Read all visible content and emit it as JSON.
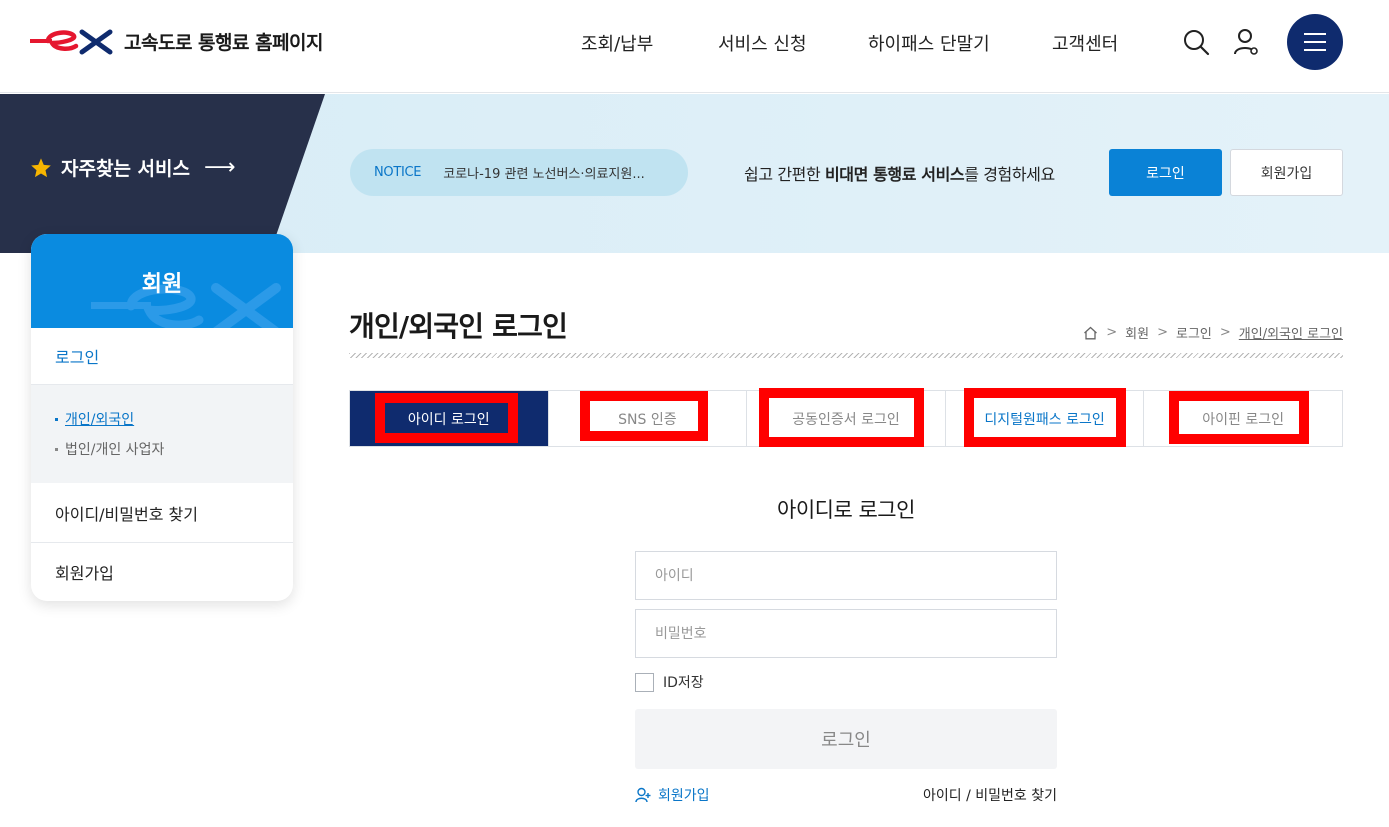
{
  "header": {
    "logo_text": "고속도로 통행료 홈페이지",
    "nav": [
      "조회/납부",
      "서비스 신청",
      "하이패스 단말기",
      "고객센터"
    ],
    "search_icon": "search-icon",
    "user_icon": "user-icon",
    "menu_icon": "hamburger-menu-icon"
  },
  "banner": {
    "favorites": "자주찾는 서비스",
    "favorites_arrow": "⟶",
    "notice_label": "NOTICE",
    "notice_text": "코로나-19 관련 노선버스·의료지원...",
    "message_pre": "쉽고 간편한 ",
    "message_bold": "비대면 통행료 서비스",
    "message_post": "를 경험하세요",
    "login_button": "로그인",
    "join_button": "회원가입"
  },
  "sidebar": {
    "title": "회원",
    "items": [
      {
        "label": "로그인"
      },
      {
        "label": "아이디/비밀번호 찾기"
      },
      {
        "label": "회원가입"
      }
    ],
    "subitems": [
      {
        "label": "개인/외국인"
      },
      {
        "label": "법인/개인 사업자"
      }
    ]
  },
  "main": {
    "title": "개인/외국인 로그인",
    "breadcrumb": [
      "회원",
      "로그인",
      "개인/외국인 로그인"
    ],
    "tabs": [
      {
        "label": "아이디 로그인"
      },
      {
        "label": "SNS 인증"
      },
      {
        "label": "공동인증서 로그인"
      },
      {
        "label": "디지털원패스 로그인"
      },
      {
        "label": "아이핀 로그인"
      }
    ],
    "login_title": "아이디로 로그인",
    "id_placeholder": "아이디",
    "pw_placeholder": "비밀번호",
    "save_id": "ID저장",
    "login_button": "로그인",
    "join_link": "회원가입",
    "find_link": "아이디 / 비밀번호 찾기"
  },
  "colors": {
    "navy": "#0f2b6e",
    "blue": "#0a82d6",
    "brand_red": "#e5172f",
    "highlight_red": "#ff0000"
  }
}
